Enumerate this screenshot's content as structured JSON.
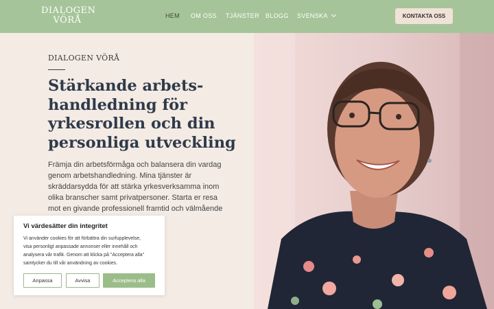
{
  "brand": {
    "line1": "DIALOGEN",
    "line2": "VÖRÅ"
  },
  "nav": {
    "items": [
      {
        "label": "HEM"
      },
      {
        "label": "OM OSS"
      },
      {
        "label": "TJÄNSTER"
      },
      {
        "label": "BLOGG"
      },
      {
        "label": "SVENSKA"
      }
    ],
    "cta_label": "KONTAKTA OSS"
  },
  "hero": {
    "eyebrow": "DIALOGEN VÖRÅ",
    "headline_lines": [
      "Stärkande arbets-",
      "handledning för",
      "yrkesrollen och din",
      "personliga utveckling"
    ],
    "body_lines": [
      "Främja din arbetsförmåga och balansera din vardag",
      "genom arbetshandledning. Mina tjänster är",
      "skräddarsydda för att stärka yrkesverksamma inom",
      "olika branscher samt privatpersoner. Starta er resa",
      "mot en givande professionell framtid och välmående"
    ]
  },
  "cookie": {
    "title": "Vi värdesätter din integritet",
    "text_lines": [
      "Vi använder cookies för att förbättra din surfupplevelse,",
      "visa personligt anpassade annonser eller innehåll och",
      "analysera vår trafik. Genom att klicka på \"Acceptera alla\"",
      "samtycker du till vår användning av cookies."
    ],
    "customize_label": "Anpassa",
    "reject_label": "Avvisa",
    "accept_label": "Acceptera alla"
  },
  "colors": {
    "header": "#a6c499",
    "background": "#f3ebe4",
    "cta": "#f0e2d6",
    "accept": "#9bbd8a",
    "heading": "#2f3a4a"
  }
}
